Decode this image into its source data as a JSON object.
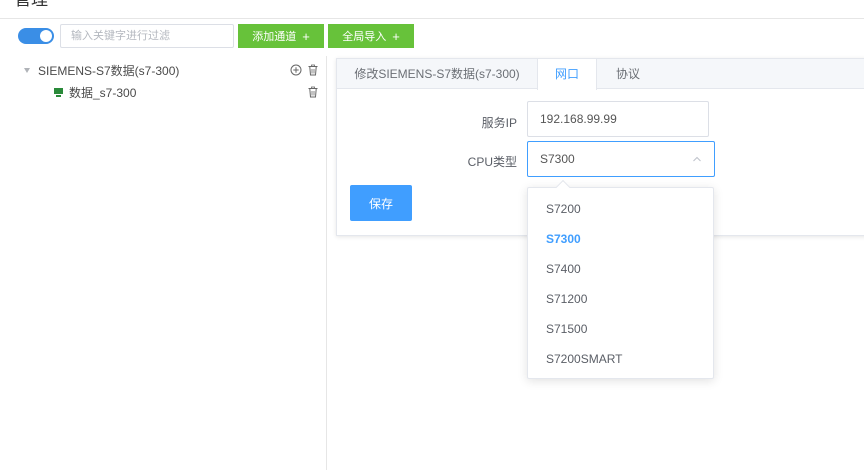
{
  "header": {
    "title": "管理"
  },
  "toolbar": {
    "filter_placeholder": "输入关键字进行过滤",
    "add_channel_label": "添加通道",
    "global_import_label": "全局导入",
    "plus": "+"
  },
  "tree": {
    "root_label": "SIEMENS-S7数据(s7-300)",
    "child_label": "数据_s7-300"
  },
  "tabs": {
    "edit": "修改SIEMENS-S7数据(s7-300)",
    "network": "网口",
    "protocol": "协议"
  },
  "form": {
    "ip_label": "服务IP",
    "ip_value": "192.168.99.99",
    "cpu_label": "CPU类型",
    "cpu_value": "S7300",
    "save_label": "保存"
  },
  "dropdown": {
    "options": [
      "S7200",
      "S7300",
      "S7400",
      "S71200",
      "S71500",
      "S7200SMART"
    ],
    "selected": "S7300"
  },
  "colors": {
    "primary": "#409eff",
    "green": "#67c23a",
    "toggle": "#3a8ee6"
  }
}
